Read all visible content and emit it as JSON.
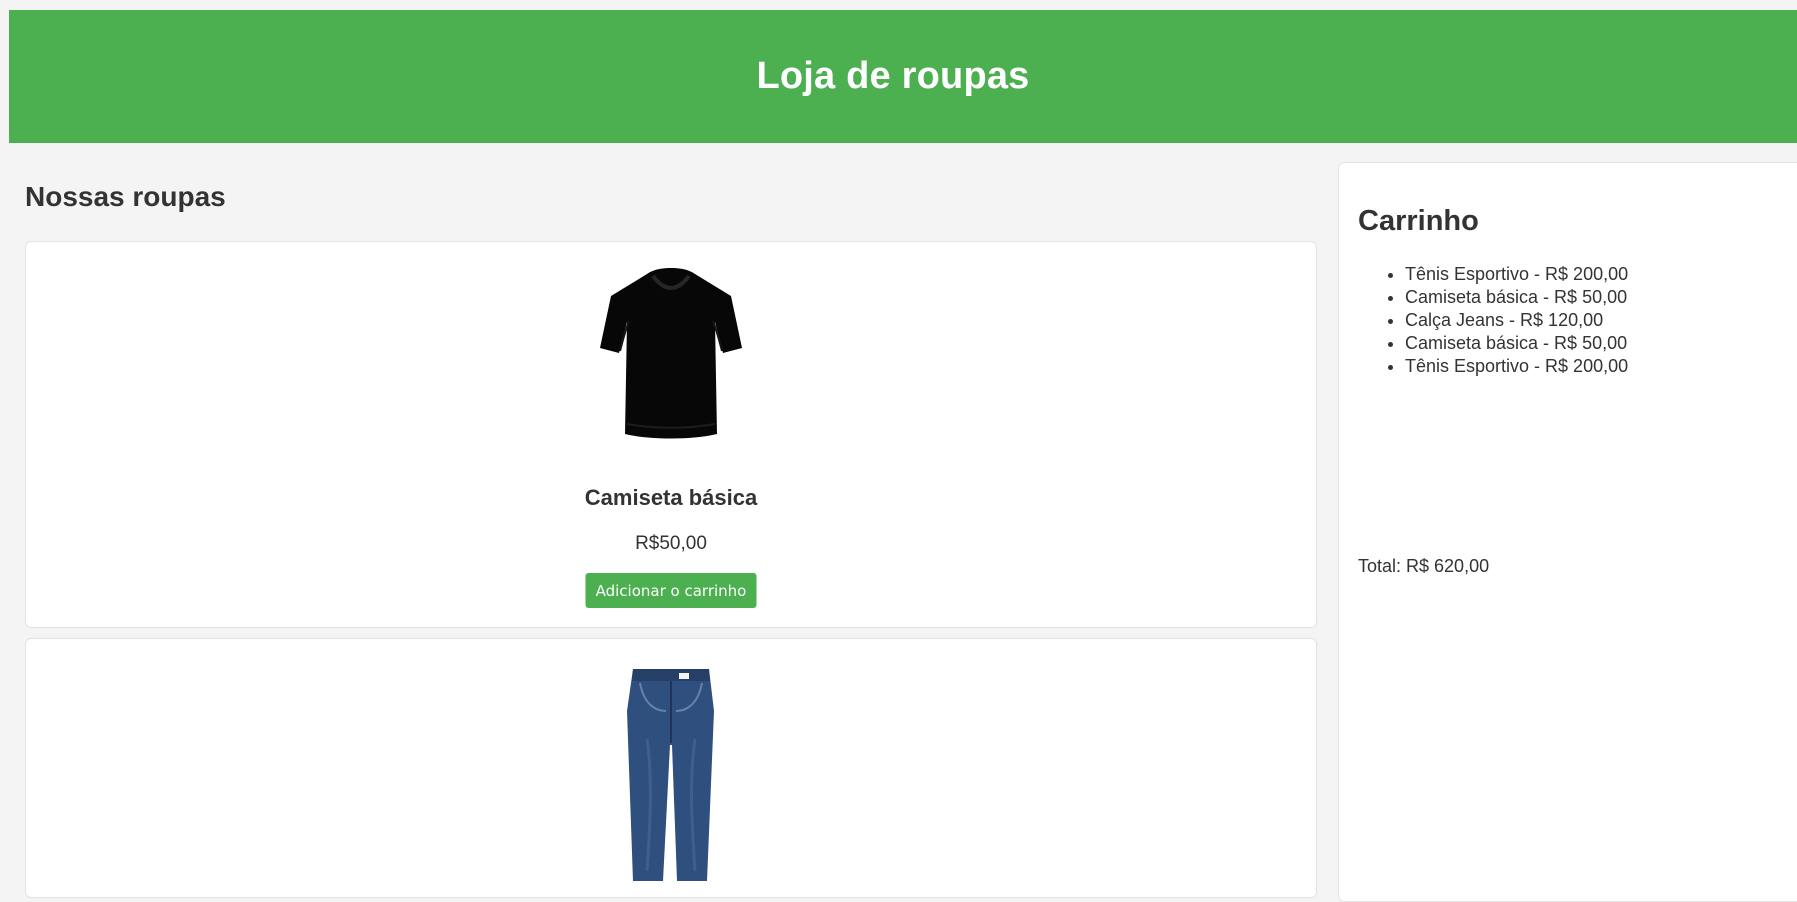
{
  "header": {
    "title": "Loja de roupas"
  },
  "catalog": {
    "title": "Nossas roupas",
    "products": [
      {
        "name": "Camiseta básica",
        "price": "R$50,00",
        "button_label": "Adicionar o carrinho",
        "image_icon": "black-tshirt-image"
      },
      {
        "image_icon": "blue-jeans-image"
      }
    ]
  },
  "cart": {
    "title": "Carrinho",
    "items": [
      "Tênis Esportivo - R$ 200,00",
      "Camiseta básica - R$ 50,00",
      "Calça Jeans - R$ 120,00",
      "Camiseta básica - R$ 50,00",
      "Tênis Esportivo - R$ 200,00"
    ],
    "total": "Total: R$ 620,00"
  },
  "colors": {
    "brand_green": "#4caf50",
    "page_background": "#f4f4f4",
    "card_background": "#ffffff",
    "text": "#333333",
    "denim": "#2f4f7f"
  }
}
